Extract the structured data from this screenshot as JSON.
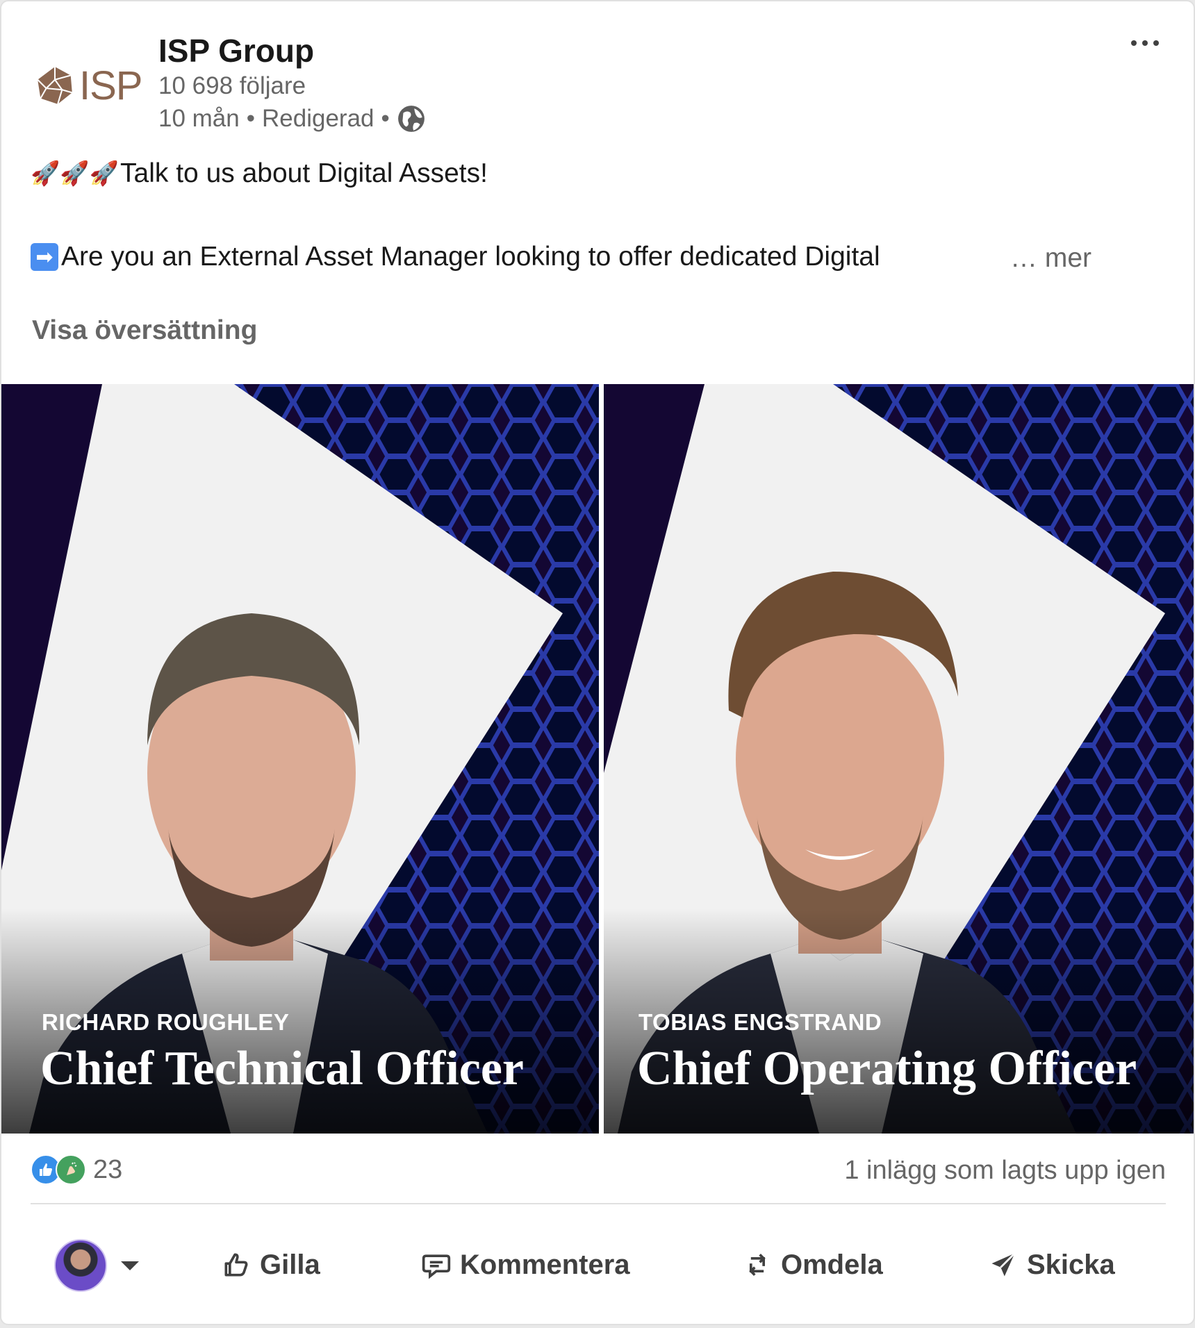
{
  "post": {
    "company_name": "ISP Group",
    "logo_text": "ISP",
    "followers": "10 698 följare",
    "time": "10 mån",
    "edited": "Redigerad",
    "separator": "•",
    "line1_text": "Talk to us about Digital Assets!",
    "line1_emoji": "🚀🚀🚀",
    "line2_emoji": "➡",
    "line2_text": "Are you an External Asset Manager looking to offer dedicated Digital",
    "see_more": "… mer",
    "translate": "Visa översättning"
  },
  "media": {
    "left": {
      "name": "RICHARD ROUGHLEY",
      "title": "Chief Technical Officer"
    },
    "right": {
      "name": "TOBIAS ENGSTRAND",
      "title": "Chief Operating Officer"
    }
  },
  "stats": {
    "reaction_count": "23",
    "reposts": "1 inlägg som lagts upp igen"
  },
  "actions": {
    "like": "Gilla",
    "comment": "Kommentera",
    "repost": "Omdela",
    "send": "Skicka"
  },
  "icons": [
    "isp-logo-icon",
    "more-options-icon",
    "globe-icon",
    "rocket-icon",
    "arrow-right-icon",
    "like-reaction-icon",
    "celebrate-reaction-icon",
    "avatar",
    "caret-down-icon",
    "like-icon",
    "comment-icon",
    "repost-icon",
    "send-icon"
  ],
  "colors": {
    "brand_logo": "#8a6650",
    "panel_background": "#140733",
    "hex_pattern": "#2a3aa8",
    "like_blue": "#378fe9",
    "celebrate_green": "#44a15e",
    "secondary_text": "#666666"
  }
}
